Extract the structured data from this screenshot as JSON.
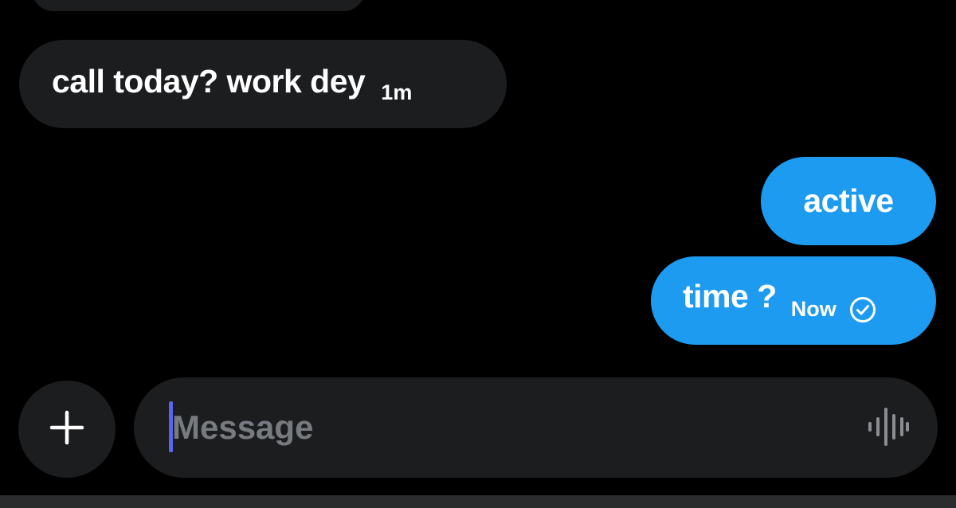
{
  "conversation": {
    "messages": [
      {
        "direction": "incoming",
        "text": "call today? work dey",
        "time": "1m"
      },
      {
        "direction": "outgoing",
        "text": "active",
        "time": ""
      },
      {
        "direction": "outgoing",
        "text": "time ?",
        "time": "Now",
        "status_icon": "sent-check-icon"
      }
    ]
  },
  "composer": {
    "placeholder": "Message",
    "value": "",
    "add_icon": "plus-icon",
    "voice_icon": "voice-waveform-icon"
  },
  "colors": {
    "background": "#000000",
    "incoming_bubble": "#1c1d1f",
    "outgoing_bubble": "#1d9bf0",
    "placeholder_text": "#777b80",
    "caret": "#5865f2"
  }
}
